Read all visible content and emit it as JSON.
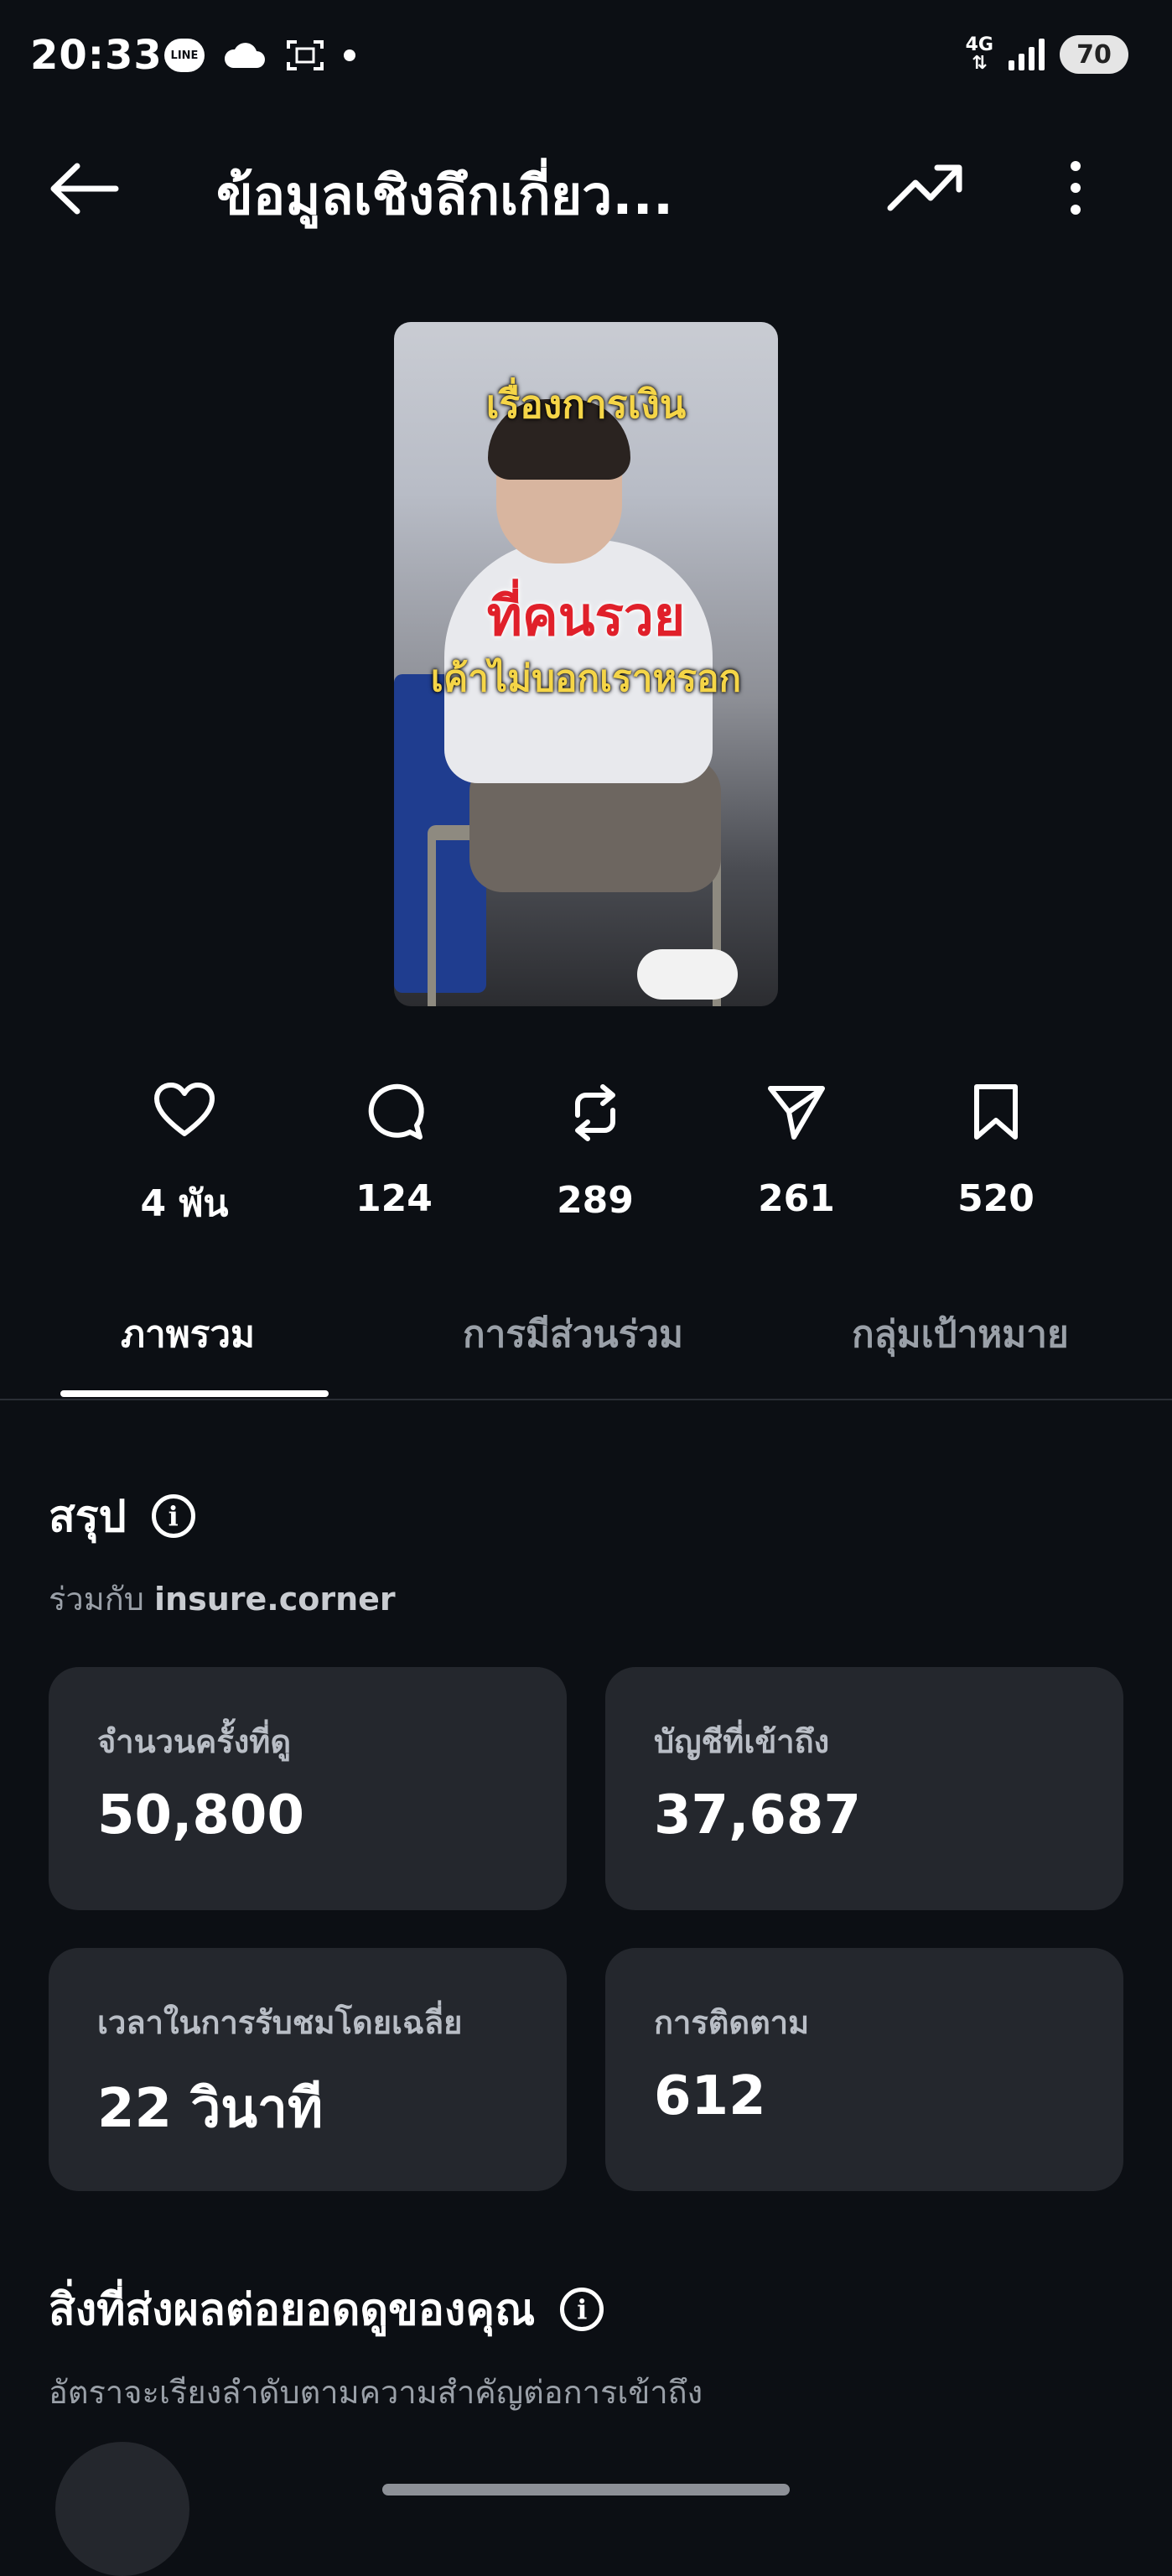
{
  "status_bar": {
    "time": "20:33",
    "line_label": "LINE",
    "network": "4G",
    "battery": "70"
  },
  "app_bar": {
    "title": "ข้อมูลเชิงลึกเกี่ยว...",
    "back_icon": "arrow-left-icon",
    "trend_icon": "trending-up-icon",
    "more_icon": "more-vertical-icon"
  },
  "thumbnail": {
    "line1": "เรื่องการเงิน",
    "line2": "ที่คนรวย",
    "line3": "เค้าไม่บอกเราหรอก"
  },
  "stats": [
    {
      "icon": "heart-icon",
      "value": "4 พัน"
    },
    {
      "icon": "comment-icon",
      "value": "124"
    },
    {
      "icon": "repost-icon",
      "value": "289"
    },
    {
      "icon": "send-icon",
      "value": "261"
    },
    {
      "icon": "bookmark-icon",
      "value": "520"
    }
  ],
  "tabs": [
    {
      "label": "ภาพรวม",
      "active": true
    },
    {
      "label": "การมีส่วนร่วม",
      "active": false
    },
    {
      "label": "กลุ่มเป้าหมาย",
      "active": false
    }
  ],
  "summary": {
    "title": "สรุป",
    "collab_prefix": "ร่วมกับ",
    "collab_account": "insure.corner",
    "cards": [
      {
        "label": "จำนวนครั้งที่ดู",
        "value": "50,800"
      },
      {
        "label": "บัญชีที่เข้าถึง",
        "value": "37,687"
      },
      {
        "label": "เวลาในการรับชมโดยเฉลี่ย",
        "value": "22 วินาที"
      },
      {
        "label": "การติดตาม",
        "value": "612"
      }
    ]
  },
  "factors": {
    "title": "สิ่งที่ส่งผลต่อยอดดูของคุณ",
    "subtitle": "อัตราจะเรียงลำดับตามความสำคัญต่อการเข้าถึง"
  },
  "colors": {
    "background": "#0c0f14",
    "card": "#24272d",
    "muted_text": "#9aa0a8"
  }
}
